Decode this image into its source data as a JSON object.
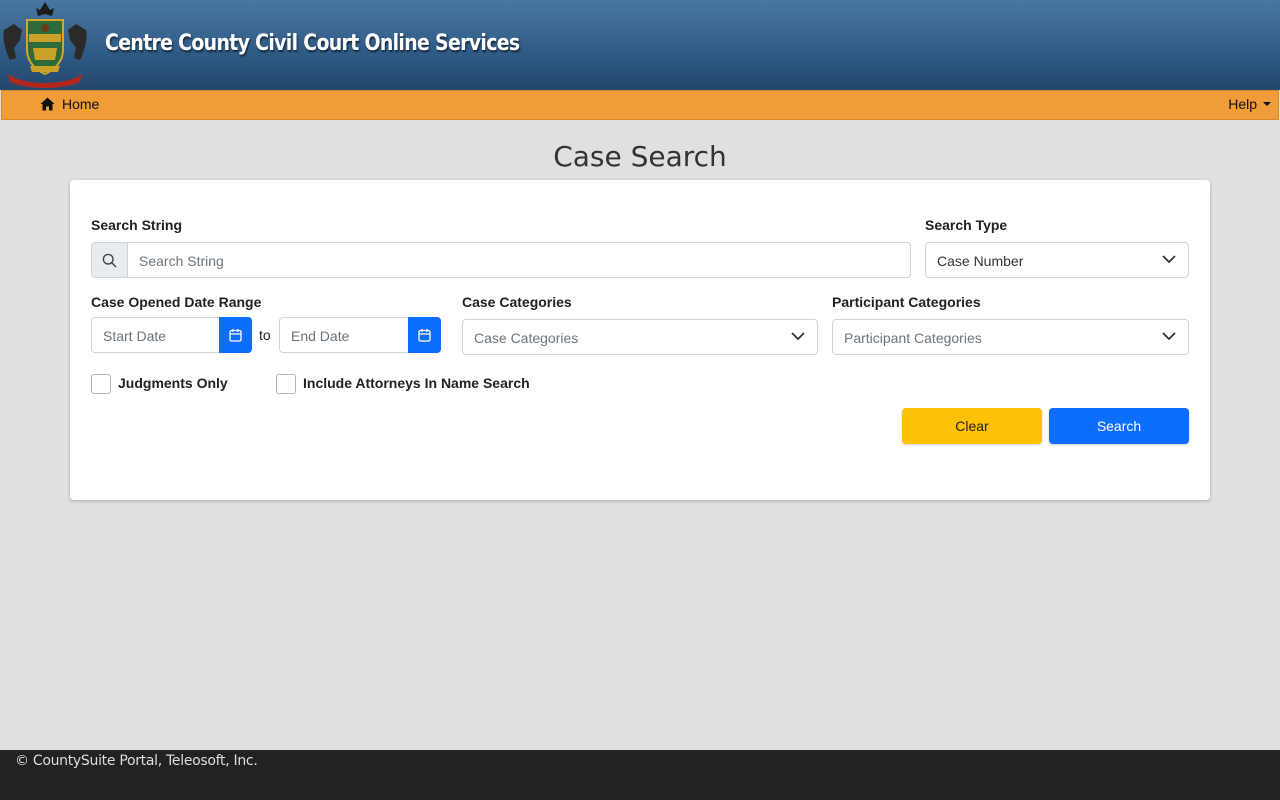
{
  "header": {
    "site_title": "Centre County Civil Court Online Services",
    "seal_icon": "pennsylvania-coat-of-arms"
  },
  "nav": {
    "home_label": "Home",
    "help_label": "Help"
  },
  "page": {
    "title": "Case Search"
  },
  "form": {
    "search_string_label": "Search String",
    "search_string_placeholder": "Search String",
    "search_type_label": "Search Type",
    "search_type_value": "Case Number",
    "date_range_label": "Case Opened Date Range",
    "start_date_placeholder": "Start Date",
    "to_label": "to",
    "end_date_placeholder": "End Date",
    "case_categories_label": "Case Categories",
    "case_categories_placeholder": "Case Categories",
    "participant_categories_label": "Participant Categories",
    "participant_categories_placeholder": "Participant Categories",
    "judgments_only_label": "Judgments Only",
    "include_attorneys_label": "Include Attorneys In Name Search",
    "clear_label": "Clear",
    "search_label": "Search"
  },
  "footer": {
    "copyright": "© CountySuite Portal, Teleosoft, Inc."
  },
  "colors": {
    "header_blue": "#2e5a85",
    "nav_orange": "#f09c38",
    "primary_blue": "#0d6efd",
    "warning_yellow": "#ffc107",
    "footer_dark": "#222222"
  }
}
